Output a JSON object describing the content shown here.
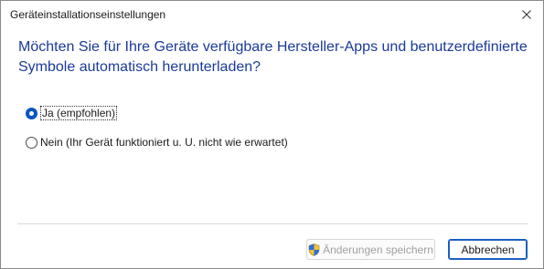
{
  "window": {
    "title": "Geräteinstallationseinstellungen"
  },
  "dialog": {
    "question": "Möchten Sie für Ihre Geräte verfügbare Hersteller-Apps und benutzerdefinierte Symbole automatisch herunterladen?",
    "options": [
      {
        "label": "Ja (empfohlen)",
        "checked": true
      },
      {
        "label": "Nein (Ihr Gerät funktioniert u. U. nicht wie erwartet)",
        "checked": false
      }
    ]
  },
  "buttons": {
    "save_label": "Änderungen speichern",
    "save_enabled": false,
    "cancel_label": "Abbrechen"
  },
  "colors": {
    "heading": "#1a3a99",
    "accent": "#0a56c0"
  }
}
